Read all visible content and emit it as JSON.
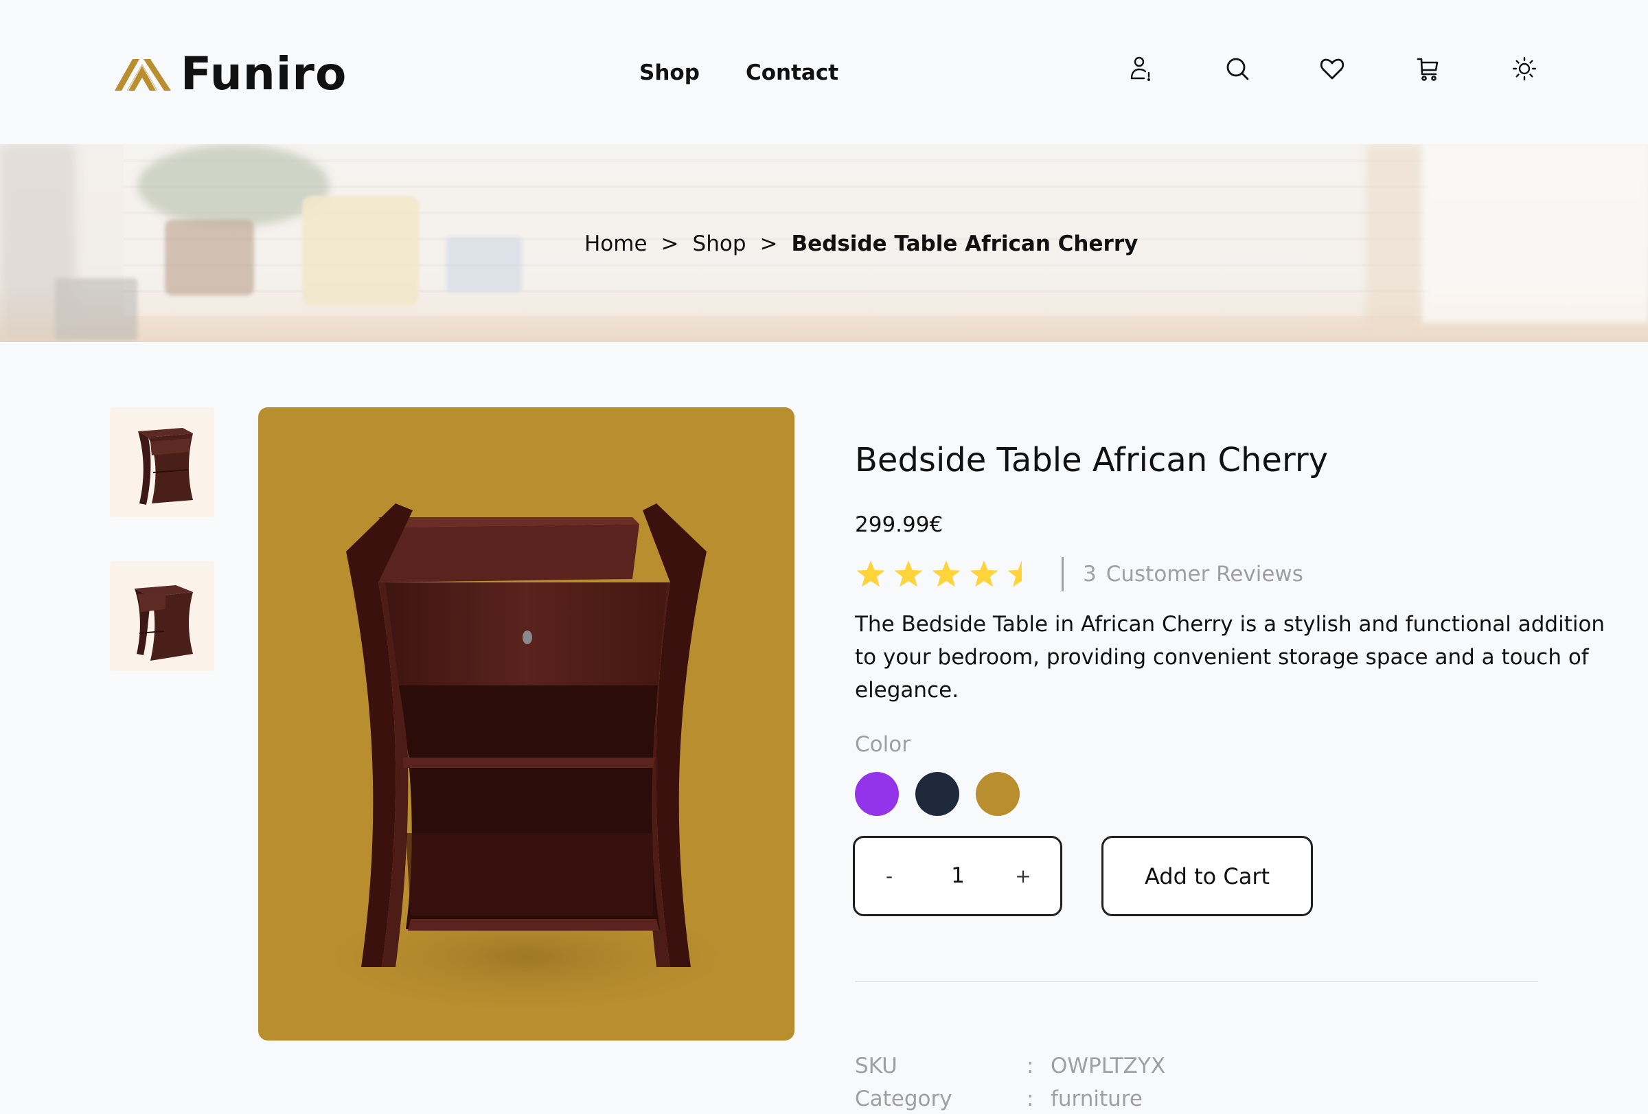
{
  "brand": {
    "name": "Funiro",
    "accent": "#B88E2F"
  },
  "nav": {
    "links": [
      "Shop",
      "Contact"
    ]
  },
  "header_icons": [
    "account-alert-icon",
    "search-icon",
    "heart-icon",
    "cart-icon",
    "sun-icon"
  ],
  "breadcrumb": {
    "items": [
      "Home",
      "Shop",
      "Bedside Table African Cherry"
    ],
    "separator": ">"
  },
  "product": {
    "title": "Bedside Table African Cherry",
    "price": "299.99€",
    "rating": 4.5,
    "rating_max": 5,
    "review_count": "3",
    "review_label": "Customer Reviews",
    "description_lines": [
      "The Bedside Table in African Cherry is a stylish and functional addition",
      "to your bedroom, providing convenient storage space and a touch of",
      "elegance."
    ],
    "color_label": "Color",
    "colors": [
      "#9333EA",
      "#1E293B",
      "#B88E2F"
    ],
    "quantity": {
      "minus_label": "-",
      "value": "1",
      "plus_label": "+"
    },
    "add_to_cart_label": "Add to Cart",
    "meta": [
      {
        "key": "SKU",
        "colon": ":",
        "value": "OWPLTZYX"
      },
      {
        "key": "Category",
        "colon": ":",
        "value": "furniture"
      }
    ]
  },
  "colors": {
    "page_bg": "#F8F9FA",
    "image_bg": "#B88E2F",
    "thumb_bg": "#FBF2E9",
    "star": "#FFD43B",
    "muted_text": "#9F9F9F"
  }
}
